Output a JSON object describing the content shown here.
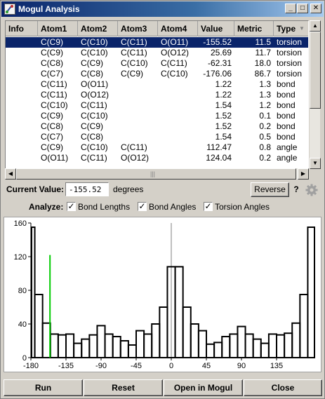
{
  "window": {
    "title": "Mogul Analysis",
    "controls": {
      "minimize": "_",
      "maximize": "□",
      "close": "✕"
    }
  },
  "table": {
    "columns": [
      "Info",
      "Atom1",
      "Atom2",
      "Atom3",
      "Atom4",
      "Value",
      "Metric",
      "Type"
    ],
    "sort_icon": "▼",
    "rows": [
      {
        "info": "",
        "atom1": "C(C9)",
        "atom2": "C(C10)",
        "atom3": "C(C11)",
        "atom4": "O(O11)",
        "value": "-155.52",
        "metric": "11.5",
        "type": "torsion"
      },
      {
        "info": "",
        "atom1": "C(C9)",
        "atom2": "C(C10)",
        "atom3": "C(C11)",
        "atom4": "O(O12)",
        "value": "25.69",
        "metric": "11.7",
        "type": "torsion"
      },
      {
        "info": "",
        "atom1": "C(C8)",
        "atom2": "C(C9)",
        "atom3": "C(C10)",
        "atom4": "C(C11)",
        "value": "-62.31",
        "metric": "18.0",
        "type": "torsion"
      },
      {
        "info": "",
        "atom1": "C(C7)",
        "atom2": "C(C8)",
        "atom3": "C(C9)",
        "atom4": "C(C10)",
        "value": "-176.06",
        "metric": "86.7",
        "type": "torsion"
      },
      {
        "info": "",
        "atom1": "C(C11)",
        "atom2": "O(O11)",
        "atom3": "",
        "atom4": "",
        "value": "1.22",
        "metric": "1.3",
        "type": "bond"
      },
      {
        "info": "",
        "atom1": "C(C11)",
        "atom2": "O(O12)",
        "atom3": "",
        "atom4": "",
        "value": "1.22",
        "metric": "1.3",
        "type": "bond"
      },
      {
        "info": "",
        "atom1": "C(C10)",
        "atom2": "C(C11)",
        "atom3": "",
        "atom4": "",
        "value": "1.54",
        "metric": "1.2",
        "type": "bond"
      },
      {
        "info": "",
        "atom1": "C(C9)",
        "atom2": "C(C10)",
        "atom3": "",
        "atom4": "",
        "value": "1.52",
        "metric": "0.1",
        "type": "bond"
      },
      {
        "info": "",
        "atom1": "C(C8)",
        "atom2": "C(C9)",
        "atom3": "",
        "atom4": "",
        "value": "1.52",
        "metric": "0.2",
        "type": "bond"
      },
      {
        "info": "",
        "atom1": "C(C7)",
        "atom2": "C(C8)",
        "atom3": "",
        "atom4": "",
        "value": "1.54",
        "metric": "0.5",
        "type": "bond"
      },
      {
        "info": "",
        "atom1": "C(C9)",
        "atom2": "C(C10)",
        "atom3": "C(C11)",
        "atom4": "",
        "value": "112.47",
        "metric": "0.8",
        "type": "angle"
      },
      {
        "info": "",
        "atom1": "O(O11)",
        "atom2": "C(C11)",
        "atom3": "O(O12)",
        "atom4": "",
        "value": "124.04",
        "metric": "0.2",
        "type": "angle"
      }
    ],
    "selected_row": 0
  },
  "scroll": {
    "up": "▲",
    "down": "▼",
    "left": "◀",
    "right": "▶",
    "grip": "|||"
  },
  "current_value": {
    "label": "Current Value:",
    "value": "-155.52",
    "unit": "degrees",
    "reverse_label": "Reverse",
    "help_label": "?",
    "settings_icon": "gear-icon"
  },
  "analyze": {
    "label": "Analyze:",
    "options": [
      {
        "label": "Bond Lengths",
        "checked": true
      },
      {
        "label": "Bond Angles",
        "checked": true
      },
      {
        "label": "Torsion Angles",
        "checked": true
      }
    ]
  },
  "chart_data": {
    "type": "bar",
    "xlim": [
      -180,
      180
    ],
    "ylim": [
      0,
      160
    ],
    "bin_width": 10,
    "xticks": [
      -180,
      -135,
      -90,
      -45,
      0,
      45,
      90,
      135
    ],
    "yticks": [
      0,
      40,
      80,
      120,
      160
    ],
    "x": [
      -175,
      -165,
      -155,
      -145,
      -135,
      -125,
      -115,
      -105,
      -95,
      -85,
      -75,
      -65,
      -55,
      -45,
      -35,
      -25,
      -15,
      -5,
      5,
      15,
      25,
      35,
      45,
      55,
      65,
      75,
      85,
      95,
      105,
      115,
      125,
      135,
      145,
      155,
      165,
      175
    ],
    "values": [
      155,
      75,
      41,
      28,
      27,
      28,
      17,
      22,
      27,
      38,
      28,
      25,
      20,
      15,
      32,
      28,
      40,
      60,
      108,
      108,
      60,
      40,
      32,
      16,
      18,
      25,
      28,
      37,
      28,
      22,
      17,
      28,
      27,
      29,
      41,
      75,
      155
    ],
    "current_value": -155.52,
    "current_value_color": "#00cc00",
    "bar_color": "#000000",
    "grid": false
  },
  "bottom_buttons": [
    "Run",
    "Reset",
    "Open in Mogul",
    "Close"
  ]
}
